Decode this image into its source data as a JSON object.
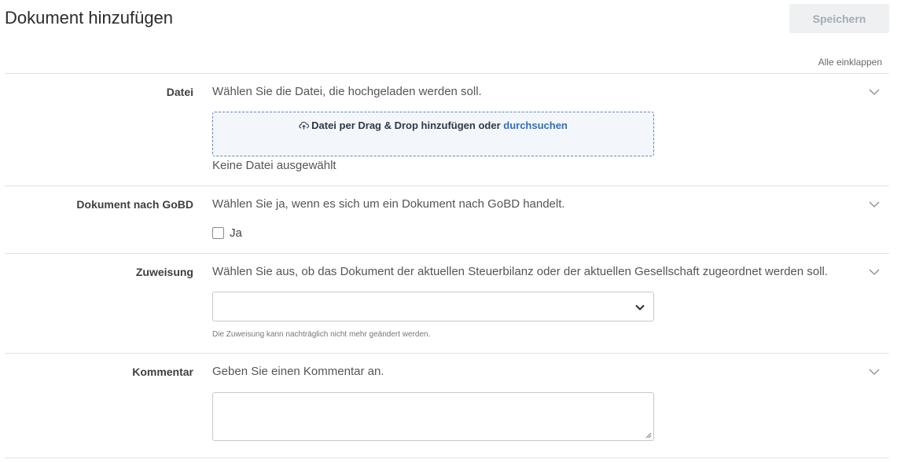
{
  "header": {
    "title": "Dokument hinzufügen",
    "save_label": "Speichern",
    "collapse_all": "Alle einklappen"
  },
  "sections": {
    "file": {
      "label": "Datei",
      "description": "Wählen Sie die Datei, die hochgeladen werden soll.",
      "dropzone_text": "Datei per Drag & Drop hinzufügen oder ",
      "browse_link": "durchsuchen",
      "no_file": "Keine Datei ausgewählt"
    },
    "gobd": {
      "label": "Dokument nach GoBD",
      "description": "Wählen Sie ja, wenn es sich um ein Dokument nach GoBD handelt.",
      "checkbox_label": "Ja",
      "checked": false
    },
    "assignment": {
      "label": "Zuweisung",
      "description": "Wählen Sie aus, ob das Dokument der aktuellen Steuerbilanz oder der aktuellen Gesellschaft zugeordnet werden soll.",
      "selected_value": "",
      "hint": "Die Zuweisung kann nachträglich nicht mehr geändert werden."
    },
    "comment": {
      "label": "Kommentar",
      "description": "Geben Sie einen Kommentar an.",
      "value": ""
    }
  },
  "icons": {
    "chevron": "chevron-down-icon",
    "upload": "upload-cloud-icon",
    "select_arrow": "chevron-down-icon",
    "resize": "resize-handle-icon"
  },
  "colors": {
    "link": "#2f6fc4",
    "dropzone_border": "#5a86c8",
    "dropzone_bg": "#f3f7fc",
    "save_disabled_bg": "#eef0f2",
    "save_disabled_text": "#a4abb6"
  }
}
